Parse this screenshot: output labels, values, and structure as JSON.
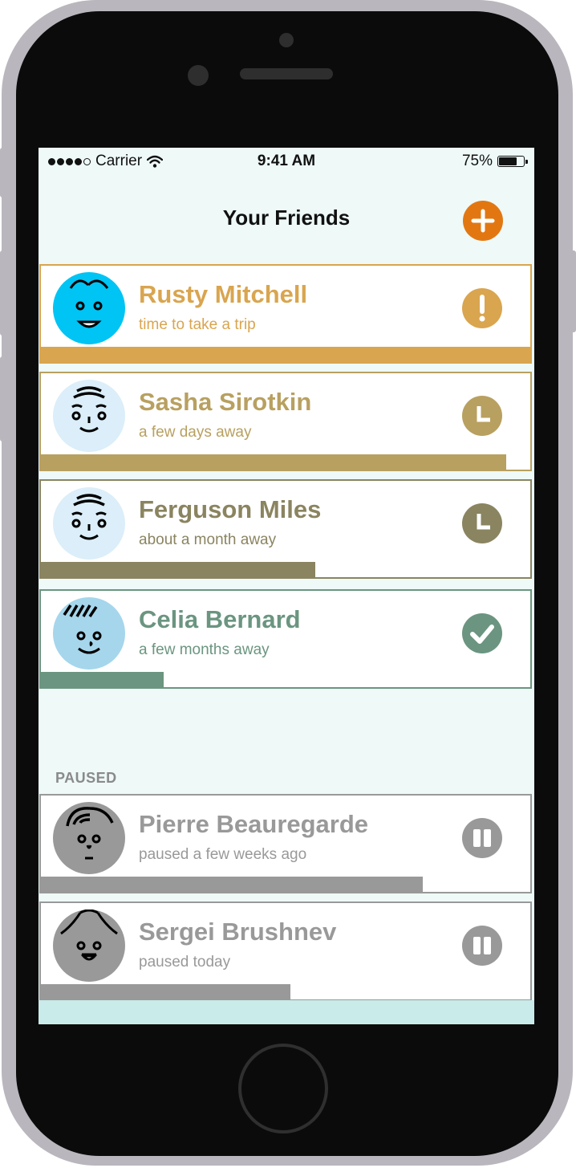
{
  "status_bar": {
    "carrier": "Carrier",
    "time": "9:41 AM",
    "battery_percent": "75%",
    "battery_level": 0.75,
    "signal_dots_filled": 4,
    "signal_dots_total": 5
  },
  "nav": {
    "title": "Your Friends",
    "add_icon": "plus-icon",
    "add_color": "#e27712"
  },
  "active_friends": [
    {
      "name": "Rusty Mitchell",
      "subtitle": "time to take a trip",
      "status_icon": "exclamation-icon",
      "accent": "#d9a54f",
      "avatar_bg": "#00c4f4",
      "progress": 1.0
    },
    {
      "name": "Sasha Sirotkin",
      "subtitle": "a few days away",
      "status_icon": "clock-icon",
      "accent": "#b8a060",
      "avatar_bg": "#dbeef9",
      "progress": 0.95
    },
    {
      "name": "Ferguson Miles",
      "subtitle": "about a month away",
      "status_icon": "clock-icon",
      "accent": "#8a8460",
      "avatar_bg": "#dbeef9",
      "progress": 0.56
    },
    {
      "name": "Celia Bernard",
      "subtitle": "a few months away",
      "status_icon": "check-icon",
      "accent": "#6b9580",
      "avatar_bg": "#a5d6ec",
      "progress": 0.25
    }
  ],
  "paused_section": {
    "header": "PAUSED",
    "friends": [
      {
        "name": "Pierre Beauregarde",
        "subtitle": "paused a few weeks ago",
        "status_icon": "pause-icon",
        "accent": "#999999",
        "avatar_bg": "#999999",
        "progress": 0.78
      },
      {
        "name": "Sergei Brushnev",
        "subtitle": "paused today",
        "status_icon": "pause-icon",
        "accent": "#999999",
        "avatar_bg": "#999999",
        "progress": 0.51
      }
    ]
  }
}
